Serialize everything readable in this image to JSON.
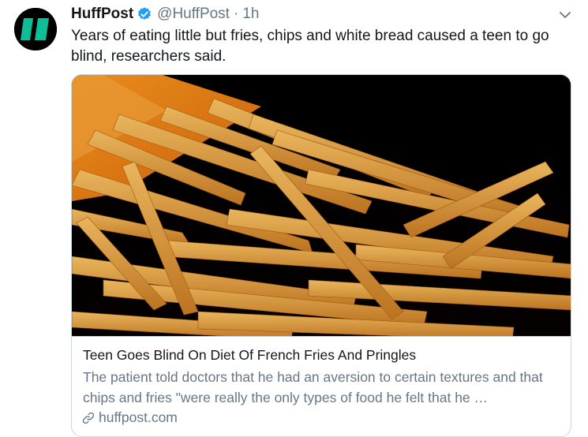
{
  "tweet": {
    "author_name": "HuffPost",
    "handle": "@HuffPost",
    "separator": "·",
    "time": "1h",
    "text": "Years of eating little but fries, chips and white bread caused a teen to go blind, researchers said."
  },
  "card": {
    "title": "Teen Goes Blind On Diet Of French Fries And Pringles",
    "description": "The patient told doctors that he had an aversion to certain textures and that chips and fries \"were really the only types of food he felt that he …",
    "domain": "huffpost.com",
    "image_subject": "french fries spilling from a carton on black background"
  },
  "icons": {
    "avatar": "huffpost-logo",
    "verified": "verified-badge-icon",
    "caret": "chevron-down-icon",
    "link": "link-icon"
  },
  "colors": {
    "brand_green": "#0dbe98",
    "verified_blue": "#1da1f2",
    "secondary_text": "#657786",
    "border": "#ccd6dd"
  }
}
